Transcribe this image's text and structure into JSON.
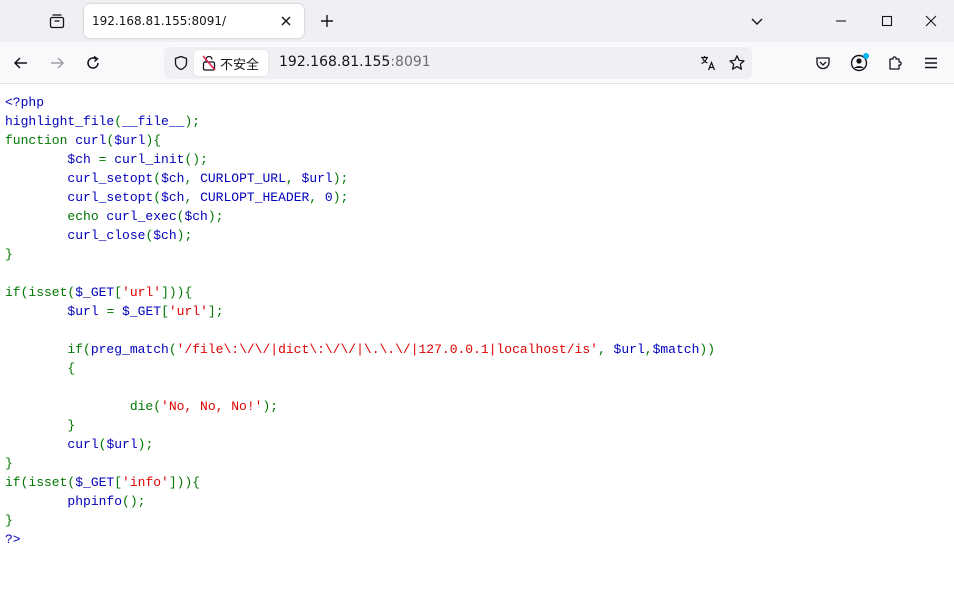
{
  "window": {
    "tab_title": "192.168.81.155:8091/"
  },
  "navbar": {
    "security_label": "不安全",
    "url_host": "192.168.81.155",
    "url_port": ":8091"
  },
  "colors": {
    "php_default": "#0000bb",
    "php_keyword": "#007700",
    "php_string": "#dd0000",
    "insecure_icon": "#e22850",
    "extension_badge": "#00b3f4"
  },
  "source_lines": [
    [
      [
        "default",
        "<?php"
      ]
    ],
    [
      [
        "default",
        "highlight_file"
      ],
      [
        "keyword",
        "("
      ],
      [
        "default",
        "__file__"
      ],
      [
        "keyword",
        ");"
      ]
    ],
    [
      [
        "keyword",
        "function "
      ],
      [
        "default",
        "curl"
      ],
      [
        "keyword",
        "("
      ],
      [
        "default",
        "$url"
      ],
      [
        "keyword",
        "){"
      ]
    ],
    [
      [
        "keyword",
        "        "
      ],
      [
        "default",
        "$ch "
      ],
      [
        "keyword",
        "= "
      ],
      [
        "default",
        "curl_init"
      ],
      [
        "keyword",
        "();"
      ]
    ],
    [
      [
        "keyword",
        "        "
      ],
      [
        "default",
        "curl_setopt"
      ],
      [
        "keyword",
        "("
      ],
      [
        "default",
        "$ch"
      ],
      [
        "keyword",
        ", "
      ],
      [
        "default",
        "CURLOPT_URL"
      ],
      [
        "keyword",
        ", "
      ],
      [
        "default",
        "$url"
      ],
      [
        "keyword",
        ");"
      ]
    ],
    [
      [
        "keyword",
        "        "
      ],
      [
        "default",
        "curl_setopt"
      ],
      [
        "keyword",
        "("
      ],
      [
        "default",
        "$ch"
      ],
      [
        "keyword",
        ", "
      ],
      [
        "default",
        "CURLOPT_HEADER"
      ],
      [
        "keyword",
        ", "
      ],
      [
        "default",
        "0"
      ],
      [
        "keyword",
        ");"
      ]
    ],
    [
      [
        "keyword",
        "        echo "
      ],
      [
        "default",
        "curl_exec"
      ],
      [
        "keyword",
        "("
      ],
      [
        "default",
        "$ch"
      ],
      [
        "keyword",
        ");"
      ]
    ],
    [
      [
        "keyword",
        "        "
      ],
      [
        "default",
        "curl_close"
      ],
      [
        "keyword",
        "("
      ],
      [
        "default",
        "$ch"
      ],
      [
        "keyword",
        ");"
      ]
    ],
    [
      [
        "keyword",
        "}"
      ]
    ],
    [
      [
        "keyword",
        ""
      ]
    ],
    [
      [
        "keyword",
        "if(isset("
      ],
      [
        "default",
        "$_GET"
      ],
      [
        "keyword",
        "["
      ],
      [
        "string",
        "'url'"
      ],
      [
        "keyword",
        "])){"
      ]
    ],
    [
      [
        "keyword",
        "        "
      ],
      [
        "default",
        "$url "
      ],
      [
        "keyword",
        "= "
      ],
      [
        "default",
        "$_GET"
      ],
      [
        "keyword",
        "["
      ],
      [
        "string",
        "'url'"
      ],
      [
        "keyword",
        "];"
      ]
    ],
    [
      [
        "keyword",
        ""
      ]
    ],
    [
      [
        "keyword",
        "        if("
      ],
      [
        "default",
        "preg_match"
      ],
      [
        "keyword",
        "("
      ],
      [
        "string",
        "'/file\\:\\/\\/|dict\\:\\/\\/|\\.\\.\\/|127.0.0.1|localhost/is'"
      ],
      [
        "keyword",
        ", "
      ],
      [
        "default",
        "$url"
      ],
      [
        "keyword",
        ","
      ],
      [
        "default",
        "$match"
      ],
      [
        "keyword",
        "))"
      ]
    ],
    [
      [
        "keyword",
        "        {"
      ]
    ],
    [
      [
        "keyword",
        ""
      ]
    ],
    [
      [
        "keyword",
        "                die("
      ],
      [
        "string",
        "'No, No, No!'"
      ],
      [
        "keyword",
        ");"
      ]
    ],
    [
      [
        "keyword",
        "        }"
      ]
    ],
    [
      [
        "keyword",
        "        "
      ],
      [
        "default",
        "curl"
      ],
      [
        "keyword",
        "("
      ],
      [
        "default",
        "$url"
      ],
      [
        "keyword",
        ");"
      ]
    ],
    [
      [
        "keyword",
        "}"
      ]
    ],
    [
      [
        "keyword",
        "if(isset("
      ],
      [
        "default",
        "$_GET"
      ],
      [
        "keyword",
        "["
      ],
      [
        "string",
        "'info'"
      ],
      [
        "keyword",
        "])){"
      ]
    ],
    [
      [
        "keyword",
        "        "
      ],
      [
        "default",
        "phpinfo"
      ],
      [
        "keyword",
        "();"
      ]
    ],
    [
      [
        "keyword",
        "}"
      ]
    ],
    [
      [
        "default",
        "?>"
      ]
    ]
  ]
}
